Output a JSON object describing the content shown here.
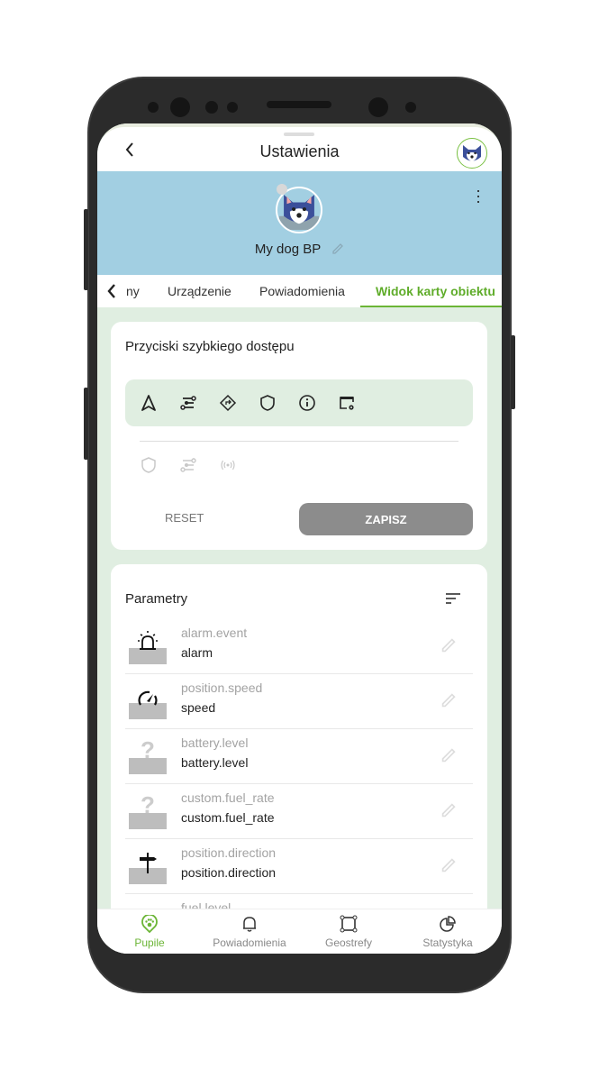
{
  "header": {
    "title": "Ustawienia",
    "back_icon": "chevron-left-icon"
  },
  "profile": {
    "name": "My dog BP",
    "banner_color": "#a2cfe2"
  },
  "tabs": {
    "items": [
      "ny",
      "Urządzenie",
      "Powiadomienia",
      "Widok karty obiektu"
    ],
    "active": "Widok karty obiektu"
  },
  "quick_access": {
    "title": "Przyciski szybkiego dostępu",
    "selected_icons": [
      "navigation-icon",
      "route-icon",
      "directions-icon",
      "shield-icon",
      "info-icon",
      "window-settings-icon"
    ],
    "available_icons": [
      "shield-icon",
      "route-icon",
      "broadcast-icon"
    ],
    "reset_label": "RESET",
    "save_label": "ZAPISZ"
  },
  "parameters": {
    "title": "Parametry",
    "items": [
      {
        "key": "alarm.event",
        "label": "alarm",
        "icon": "siren-icon"
      },
      {
        "key": "position.speed",
        "label": "speed",
        "icon": "speedometer-icon"
      },
      {
        "key": "battery.level",
        "label": "battery.level",
        "icon": "question-icon"
      },
      {
        "key": "custom.fuel_rate",
        "label": "custom.fuel_rate",
        "icon": "question-icon"
      },
      {
        "key": "position.direction",
        "label": "position.direction",
        "icon": "signpost-icon"
      },
      {
        "key": "fuel.level",
        "label": "",
        "icon": ""
      }
    ]
  },
  "bottom_nav": {
    "items": [
      "Pupile",
      "Powiadomienia",
      "Geostrefy",
      "Statystyka"
    ],
    "active": "Pupile"
  },
  "colors": {
    "accent": "#6bb536",
    "content_bg": "#e0eee1",
    "save_button": "#8c8c8c"
  }
}
